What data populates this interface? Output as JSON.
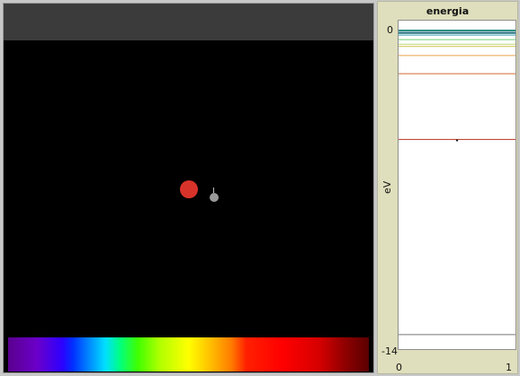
{
  "chart_data": {
    "type": "line",
    "title": "energia",
    "ylabel": "eV",
    "xlabel": "",
    "ylim": [
      -14,
      0
    ],
    "xlim": [
      0,
      1
    ],
    "y_tick_labels": [
      "0",
      "-14"
    ],
    "x_tick_labels": [
      "0",
      "1"
    ],
    "grid": false,
    "series": [
      {
        "level": -0.2,
        "color": "#2f8f85"
      },
      {
        "level": -0.3,
        "color": "#1b6b78"
      },
      {
        "level": -0.4,
        "color": "#3aa0b0"
      },
      {
        "level": -0.6,
        "color": "#6fcf6f"
      },
      {
        "level": -0.8,
        "color": "#b8d96a"
      },
      {
        "level": -0.9,
        "color": "#d4c24a"
      },
      {
        "level": -1.3,
        "color": "#e8a24a"
      },
      {
        "level": -2.1,
        "color": "#d2692d"
      },
      {
        "level": -5.0,
        "color": "#b5331e"
      },
      {
        "level": -13.6,
        "color": "#777777"
      }
    ],
    "marker": {
      "x": 0.5,
      "level": -5.0
    }
  }
}
